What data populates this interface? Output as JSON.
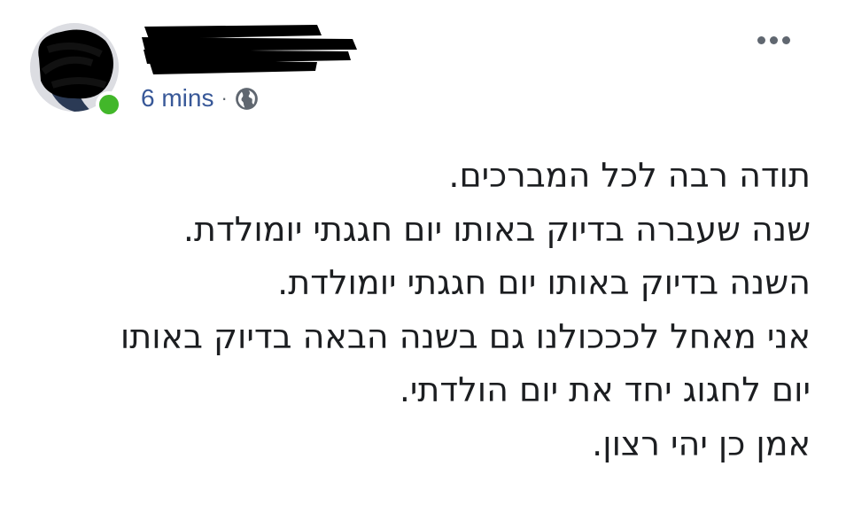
{
  "header": {
    "timestamp": "6 mins",
    "separator": "·",
    "privacy_icon": "globe-icon",
    "more_icon": "more-options-icon"
  },
  "post": {
    "lines": [
      "תודה רבה לכל המברכים.",
      "שנה שעברה בדיוק באותו יום חגגתי יומולדת.",
      "השנה בדיוק באותו יום חגגתי יומולדת.",
      "אני מאחל לכככולנו גם בשנה הבאה בדיוק באותו",
      "יום לחגוג יחד את יום הולדתי.",
      "אמן כן יהי רצון."
    ]
  },
  "colors": {
    "timestamp": "#385898",
    "online": "#42b72a",
    "text": "#1c1e21",
    "icon_gray": "#606770"
  }
}
